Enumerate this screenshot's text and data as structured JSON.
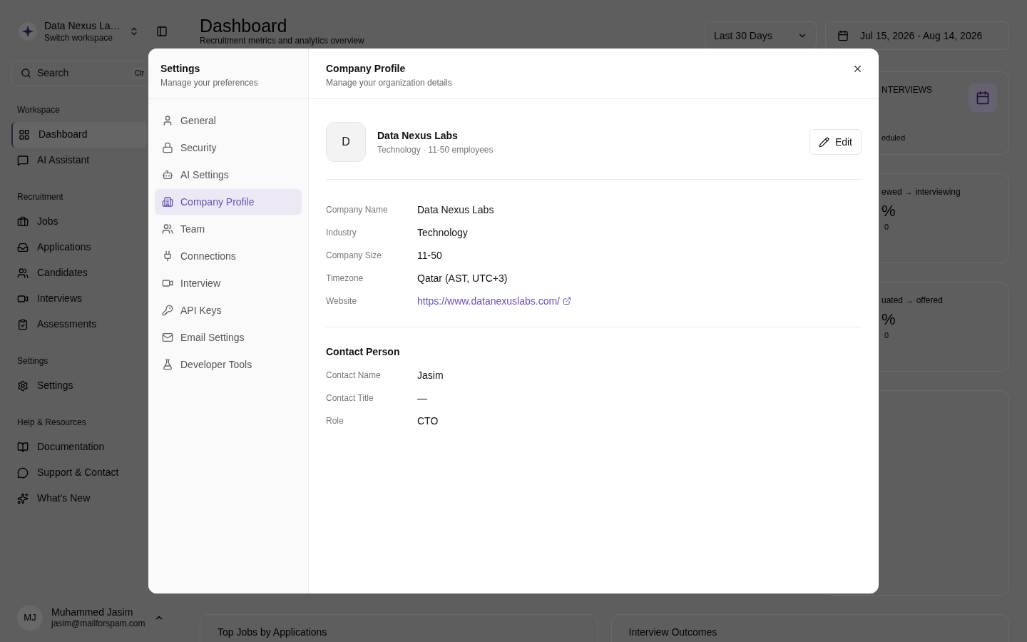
{
  "workspace": {
    "name": "Data Nexus La…",
    "subtitle": "Switch workspace"
  },
  "search": {
    "placeholder": "Search",
    "shortcut": "Ctr"
  },
  "sidebar": [
    {
      "heading": "Workspace",
      "items": [
        {
          "label": "Dashboard",
          "selected": true
        },
        {
          "label": "AI Assistant",
          "selected": false
        }
      ]
    },
    {
      "heading": "Recruitment",
      "items": [
        {
          "label": "Jobs",
          "selected": false
        },
        {
          "label": "Applications",
          "selected": false
        },
        {
          "label": "Candidates",
          "selected": false
        },
        {
          "label": "Interviews",
          "selected": false
        },
        {
          "label": "Assessments",
          "selected": false
        }
      ]
    },
    {
      "heading": "Settings",
      "items": [
        {
          "label": "Settings",
          "selected": false
        }
      ]
    },
    {
      "heading": "Help & Resources",
      "items": [
        {
          "label": "Documentation",
          "selected": false
        },
        {
          "label": "Support & Contact",
          "selected": false
        },
        {
          "label": "What's New",
          "selected": false
        }
      ]
    }
  ],
  "user": {
    "initials": "MJ",
    "name": "Muhammed Jasim",
    "email": "jasim@mailforspam.com"
  },
  "page": {
    "title": "Dashboard",
    "subtitle": "Recruitment metrics and analytics overview",
    "range_select": "Last 30 Days",
    "date_range": "Jul 15, 2026 - Aug 14, 2026"
  },
  "side_cards": [
    {
      "label": "NTERVIEWS",
      "note": "eduled"
    },
    {
      "label": "ewed → interviewing",
      "value": "%",
      "count": "0"
    },
    {
      "label": "uated → offered",
      "value": "%",
      "count": "0"
    }
  ],
  "bottom_cards": [
    "Top Jobs by Applications",
    "Interview Outcomes"
  ],
  "dialog": {
    "nav_title": "Settings",
    "nav_subtitle": "Manage your preferences",
    "nav": [
      {
        "label": "General",
        "selected": false
      },
      {
        "label": "Security",
        "selected": false
      },
      {
        "label": "AI Settings",
        "selected": false
      },
      {
        "label": "Company Profile",
        "selected": true
      },
      {
        "label": "Team",
        "selected": false
      },
      {
        "label": "Connections",
        "selected": false
      },
      {
        "label": "Interview",
        "selected": false
      },
      {
        "label": "API Keys",
        "selected": false
      },
      {
        "label": "Email Settings",
        "selected": false
      },
      {
        "label": "Developer Tools",
        "selected": false
      }
    ],
    "title": "Company Profile",
    "subtitle": "Manage your organization details",
    "company": {
      "initial": "D",
      "name": "Data Nexus Labs",
      "meta": "Technology · 11-50 employees",
      "edit": "Edit"
    },
    "fields": [
      {
        "label": "Company Name",
        "value": "Data Nexus Labs",
        "kind": "text"
      },
      {
        "label": "Industry",
        "value": "Technology",
        "kind": "text"
      },
      {
        "label": "Company Size",
        "value": "11-50",
        "kind": "text"
      },
      {
        "label": "Timezone",
        "value": "Qatar (AST, UTC+3)",
        "kind": "text"
      },
      {
        "label": "Website",
        "value": "https://www.datanexuslabs.com/",
        "kind": "link"
      }
    ],
    "contact_heading": "Contact Person",
    "contact": [
      {
        "label": "Contact Name",
        "value": "Jasim"
      },
      {
        "label": "Contact Title",
        "value": "—"
      },
      {
        "label": "Role",
        "value": "CTO"
      }
    ]
  }
}
